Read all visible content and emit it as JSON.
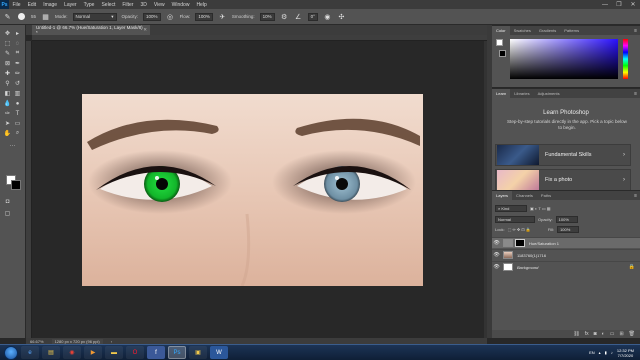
{
  "app": {
    "logo": "Ps",
    "menu": [
      "File",
      "Edit",
      "Image",
      "Layer",
      "Type",
      "Select",
      "Filter",
      "3D",
      "View",
      "Window",
      "Help"
    ],
    "window_controls": [
      "—",
      "❐",
      "✕"
    ]
  },
  "options_bar": {
    "brush_size": "55",
    "mode_label": "Mode:",
    "mode_value": "Normal",
    "opacity_label": "Opacity:",
    "opacity_value": "100%",
    "flow_label": "Flow:",
    "flow_value": "100%",
    "smoothing_label": "Smoothing:",
    "smoothing_value": "10%",
    "angle_value": "0°"
  },
  "document": {
    "tab_title": "Untitled-1 @ 66.7% (Hue/Saturation 1, Layer Mask/8) *",
    "zoom": "66.67%",
    "doc_info": "1280 px x 720 px (96 ppi)"
  },
  "color_panel": {
    "tabs": [
      "Color",
      "Swatches",
      "Gradients",
      "Patterns"
    ],
    "fg_color": "#ffffff",
    "bg_color": "#000000"
  },
  "learn_panel": {
    "tabs": [
      "Learn",
      "Libraries",
      "Adjustments"
    ],
    "title": "Learn Photoshop",
    "description": "Step-by-step tutorials directly in the app. Pick a topic below to begin.",
    "cards": [
      {
        "label": "Fundamental Skills"
      },
      {
        "label": "Fix a photo"
      }
    ]
  },
  "layers_panel": {
    "tabs": [
      "Layers",
      "Channels",
      "Paths"
    ],
    "filter_kind": "Kind",
    "blend_mode": "Normal",
    "opacity_label": "Opacity:",
    "opacity_value": "100%",
    "lock_label": "Lock:",
    "fill_label": "Fill:",
    "fill_value": "100%",
    "layers": [
      {
        "name": "Hue/Saturation 1",
        "selected": true
      },
      {
        "name": "1183760(1)1716",
        "selected": false
      },
      {
        "name": "Background",
        "selected": false
      }
    ]
  },
  "taskbar": {
    "apps": [
      "IE",
      "Files",
      "Chrome",
      "Media",
      "Folder",
      "Opera",
      "Facebook",
      "Ps",
      "Files2",
      "Word"
    ],
    "language": "EN",
    "time": "12:32 PM",
    "date": "7/7/2020"
  }
}
